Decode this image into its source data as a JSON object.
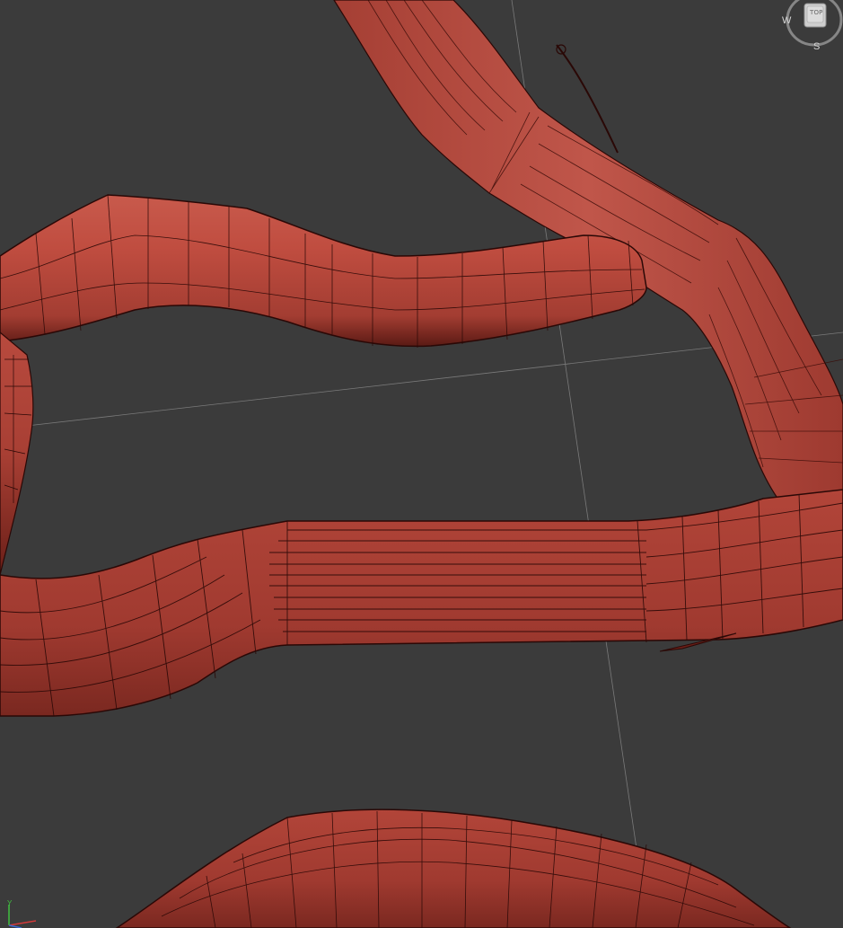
{
  "viewport": {
    "background": "#3b3b3b",
    "grid_color": "#8a8a8a",
    "mesh_color": "#b5453a",
    "wire_color": "#2a0806"
  },
  "viewcube": {
    "face_label": "TOP",
    "compass_west": "W",
    "compass_south": "S"
  },
  "axis_tripod": {
    "y_label": "Y",
    "colors": {
      "x": "#d23a3a",
      "y": "#3fbf3f",
      "z": "#3a6ad2"
    }
  }
}
